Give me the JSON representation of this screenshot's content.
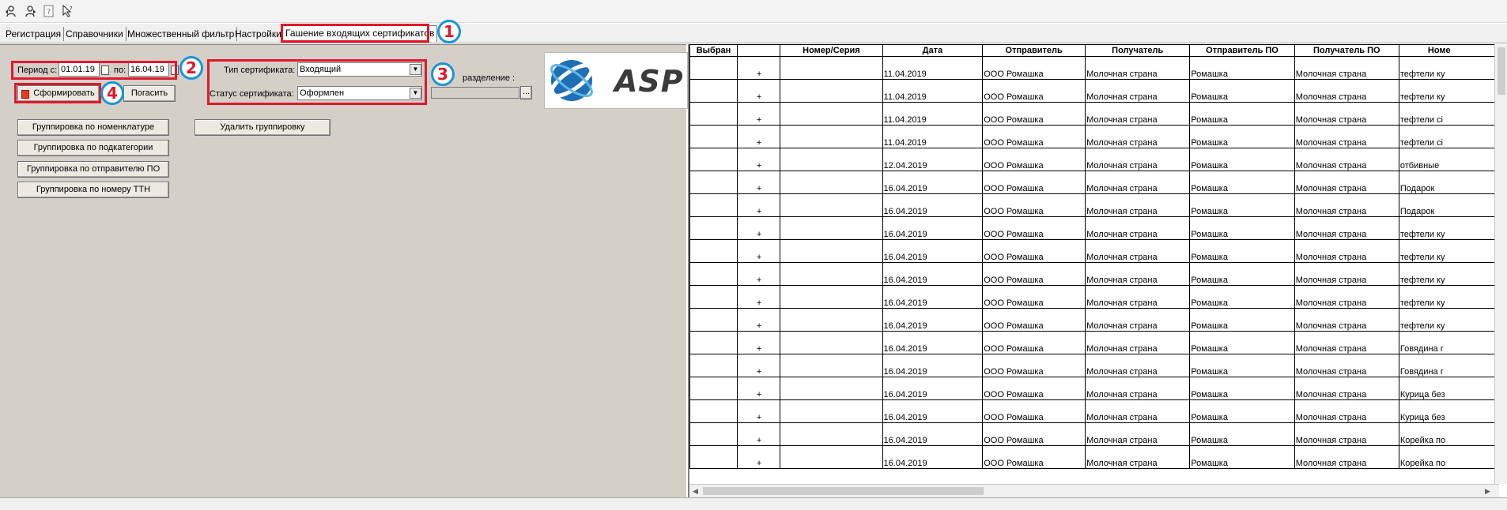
{
  "toolbar": {
    "icons": [
      "user-back-icon",
      "user-forward-icon",
      "help-icon",
      "pointer-help-icon"
    ]
  },
  "tabs": [
    {
      "label": "Регистрация"
    },
    {
      "label": "Справочники"
    },
    {
      "label": "Множественный фильтр"
    },
    {
      "label": "Настройки"
    },
    {
      "label": "Гашение входящих сертификатов",
      "active": true
    }
  ],
  "badges": {
    "b1": "1",
    "b2": "2",
    "b3": "3",
    "b4": "4"
  },
  "filters": {
    "period_from_label": "Период с:",
    "period_from_value": "01.01.19",
    "period_to_label": "по:",
    "period_to_value": "16.04.19",
    "cert_type_label": "Тип сертификата:",
    "cert_type_value": "Входящий",
    "cert_status_label": "Статус сертификата:",
    "cert_status_value": "Оформлен",
    "division_label": "разделение :",
    "division_value": ""
  },
  "actions": {
    "generate": "Сформировать",
    "cancel": "Погасить"
  },
  "grouping": {
    "by_nomenclature": "Группировка по номенклатуре",
    "by_subcategory": "Группировка по подкатегории",
    "by_sender_po": "Группировка по отправителю ПО",
    "by_ttn": "Группировка по номеру ТТН",
    "remove": "Удалить группировку"
  },
  "logo": {
    "text": "ASP",
    "accent": "#1f6fb5"
  },
  "colors": {
    "highlight": "#e0182d",
    "badge_ring": "#1a96d4",
    "panel": "#d4d0c8"
  },
  "table": {
    "columns": [
      "Выбран",
      "",
      "Номер/Серия",
      "Дата",
      "Отправитель",
      "Получатель",
      "Отправитель ПО",
      "Получатель ПО",
      "Номе"
    ],
    "rows": [
      {
        "sel": "",
        "mark": "+",
        "num": "",
        "date": "11.04.2019",
        "sender": "ООО Ромашка",
        "recipient": "Молочная страна",
        "sender_po": "Ромашка",
        "recipient_po": "Молочная страна",
        "name": "тефтели ку"
      },
      {
        "sel": "",
        "mark": "+",
        "num": "",
        "date": "11.04.2019",
        "sender": "ООО Ромашка",
        "recipient": "Молочная страна",
        "sender_po": "Ромашка",
        "recipient_po": "Молочная страна",
        "name": "тефтели ку"
      },
      {
        "sel": "",
        "mark": "+",
        "num": "",
        "date": "11.04.2019",
        "sender": "ООО Ромашка",
        "recipient": "Молочная страна",
        "sender_po": "Ромашка",
        "recipient_po": "Молочная страна",
        "name": "тефтели сі"
      },
      {
        "sel": "",
        "mark": "+",
        "num": "",
        "date": "11.04.2019",
        "sender": "ООО Ромашка",
        "recipient": "Молочная страна",
        "sender_po": "Ромашка",
        "recipient_po": "Молочная страна",
        "name": "тефтели сі"
      },
      {
        "sel": "",
        "mark": "+",
        "num": "",
        "date": "12.04.2019",
        "sender": "ООО Ромашка",
        "recipient": "Молочная страна",
        "sender_po": "Ромашка",
        "recipient_po": "Молочная страна",
        "name": "отбивные"
      },
      {
        "sel": "",
        "mark": "+",
        "num": "",
        "date": "16.04.2019",
        "sender": "ООО Ромашка",
        "recipient": "Молочная страна",
        "sender_po": "Ромашка",
        "recipient_po": "Молочная страна",
        "name": "Подарок"
      },
      {
        "sel": "",
        "mark": "+",
        "num": "",
        "date": "16.04.2019",
        "sender": "ООО Ромашка",
        "recipient": "Молочная страна",
        "sender_po": "Ромашка",
        "recipient_po": "Молочная страна",
        "name": "Подарок"
      },
      {
        "sel": "",
        "mark": "+",
        "num": "",
        "date": "16.04.2019",
        "sender": "ООО Ромашка",
        "recipient": "Молочная страна",
        "sender_po": "Ромашка",
        "recipient_po": "Молочная страна",
        "name": "тефтели ку"
      },
      {
        "sel": "",
        "mark": "+",
        "num": "",
        "date": "16.04.2019",
        "sender": "ООО Ромашка",
        "recipient": "Молочная страна",
        "sender_po": "Ромашка",
        "recipient_po": "Молочная страна",
        "name": "тефтели ку"
      },
      {
        "sel": "",
        "mark": "+",
        "num": "",
        "date": "16.04.2019",
        "sender": "ООО Ромашка",
        "recipient": "Молочная страна",
        "sender_po": "Ромашка",
        "recipient_po": "Молочная страна",
        "name": "тефтели ку"
      },
      {
        "sel": "",
        "mark": "+",
        "num": "",
        "date": "16.04.2019",
        "sender": "ООО Ромашка",
        "recipient": "Молочная страна",
        "sender_po": "Ромашка",
        "recipient_po": "Молочная страна",
        "name": "тефтели ку"
      },
      {
        "sel": "",
        "mark": "+",
        "num": "",
        "date": "16.04.2019",
        "sender": "ООО Ромашка",
        "recipient": "Молочная страна",
        "sender_po": "Ромашка",
        "recipient_po": "Молочная страна",
        "name": "тефтели ку"
      },
      {
        "sel": "",
        "mark": "+",
        "num": "",
        "date": "16.04.2019",
        "sender": "ООО Ромашка",
        "recipient": "Молочная страна",
        "sender_po": "Ромашка",
        "recipient_po": "Молочная страна",
        "name": "Говядина г"
      },
      {
        "sel": "",
        "mark": "+",
        "num": "",
        "date": "16.04.2019",
        "sender": "ООО Ромашка",
        "recipient": "Молочная страна",
        "sender_po": "Ромашка",
        "recipient_po": "Молочная страна",
        "name": "Говядина г"
      },
      {
        "sel": "",
        "mark": "+",
        "num": "",
        "date": "16.04.2019",
        "sender": "ООО Ромашка",
        "recipient": "Молочная страна",
        "sender_po": "Ромашка",
        "recipient_po": "Молочная страна",
        "name": "Курица без"
      },
      {
        "sel": "",
        "mark": "+",
        "num": "",
        "date": "16.04.2019",
        "sender": "ООО Ромашка",
        "recipient": "Молочная страна",
        "sender_po": "Ромашка",
        "recipient_po": "Молочная страна",
        "name": "Курица без"
      },
      {
        "sel": "",
        "mark": "+",
        "num": "",
        "date": "16.04.2019",
        "sender": "ООО Ромашка",
        "recipient": "Молочная страна",
        "sender_po": "Ромашка",
        "recipient_po": "Молочная страна",
        "name": "Корейка по"
      },
      {
        "sel": "",
        "mark": "+",
        "num": "",
        "date": "16.04.2019",
        "sender": "ООО Ромашка",
        "recipient": "Молочная страна",
        "sender_po": "Ромашка",
        "recipient_po": "Молочная страна",
        "name": "Корейка по"
      }
    ]
  }
}
